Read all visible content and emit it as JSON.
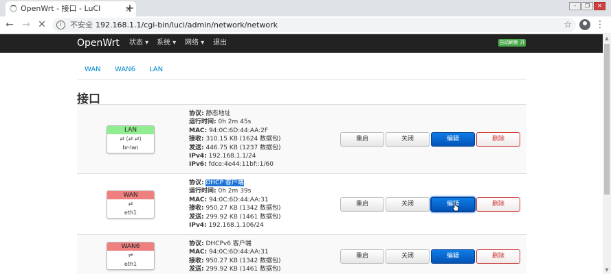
{
  "browser": {
    "tab_title": "OpenWrt - 接口 - LuCI",
    "tab_close": "×",
    "new_tab": "+",
    "insecure_label": "不安全",
    "url": "192.168.1.1/cgi-bin/luci/admin/network/network",
    "star": "☆",
    "menu": "⋮"
  },
  "app": {
    "brand": "OpenWrt",
    "menu": [
      "状态 ▾",
      "系统 ▾",
      "网络 ▾",
      "退出"
    ],
    "autorefresh": "自动刷新 开"
  },
  "tabs": [
    "WAN",
    "WAN6",
    "LAN"
  ],
  "page_title": "接口",
  "labels": {
    "protocol": "协议:",
    "uptime": "运行时间:",
    "mac": "MAC:",
    "rx": "接收:",
    "tx": "发送:",
    "ipv4": "IPv4:",
    "ipv6": "IPv6:"
  },
  "buttons": {
    "restart": "重启",
    "stop": "关闭",
    "edit": "编辑",
    "delete": "删除"
  },
  "interfaces": [
    {
      "name": "LAN",
      "color": "#90ee90",
      "icon_text": "🔗 (🔗🔗)",
      "device": "br-lan",
      "protocol": "静态地址",
      "uptime": "0h 2m 45s",
      "mac": "94:0C:6D:44:AA:2F",
      "rx": "310.15 KB (1624 数据包)",
      "tx": "446.75 KB (1237 数据包)",
      "ipv4": "192.168.1.1/24",
      "ipv6": "fdce:4e44:11bf::1/60"
    },
    {
      "name": "WAN",
      "color": "#f08080",
      "icon_text": "🔗",
      "device": "eth1",
      "protocol": "DHCP 客户端",
      "uptime": "0h 2m 39s",
      "mac": "94:0C:6D:44:AA:31",
      "rx": "950.27 KB (1342 数据包)",
      "tx": "299.92 KB (1461 数据包)",
      "ipv4": "192.168.1.106/24"
    },
    {
      "name": "WAN6",
      "color": "#f08080",
      "icon_text": "🔗",
      "device": "eth1",
      "protocol": "DHCPv6 客户端",
      "mac": "94:0C:6D:44:AA:31",
      "rx": "950.27 KB (1342 数据包)",
      "tx": "299.92 KB (1461 数据包)"
    }
  ]
}
